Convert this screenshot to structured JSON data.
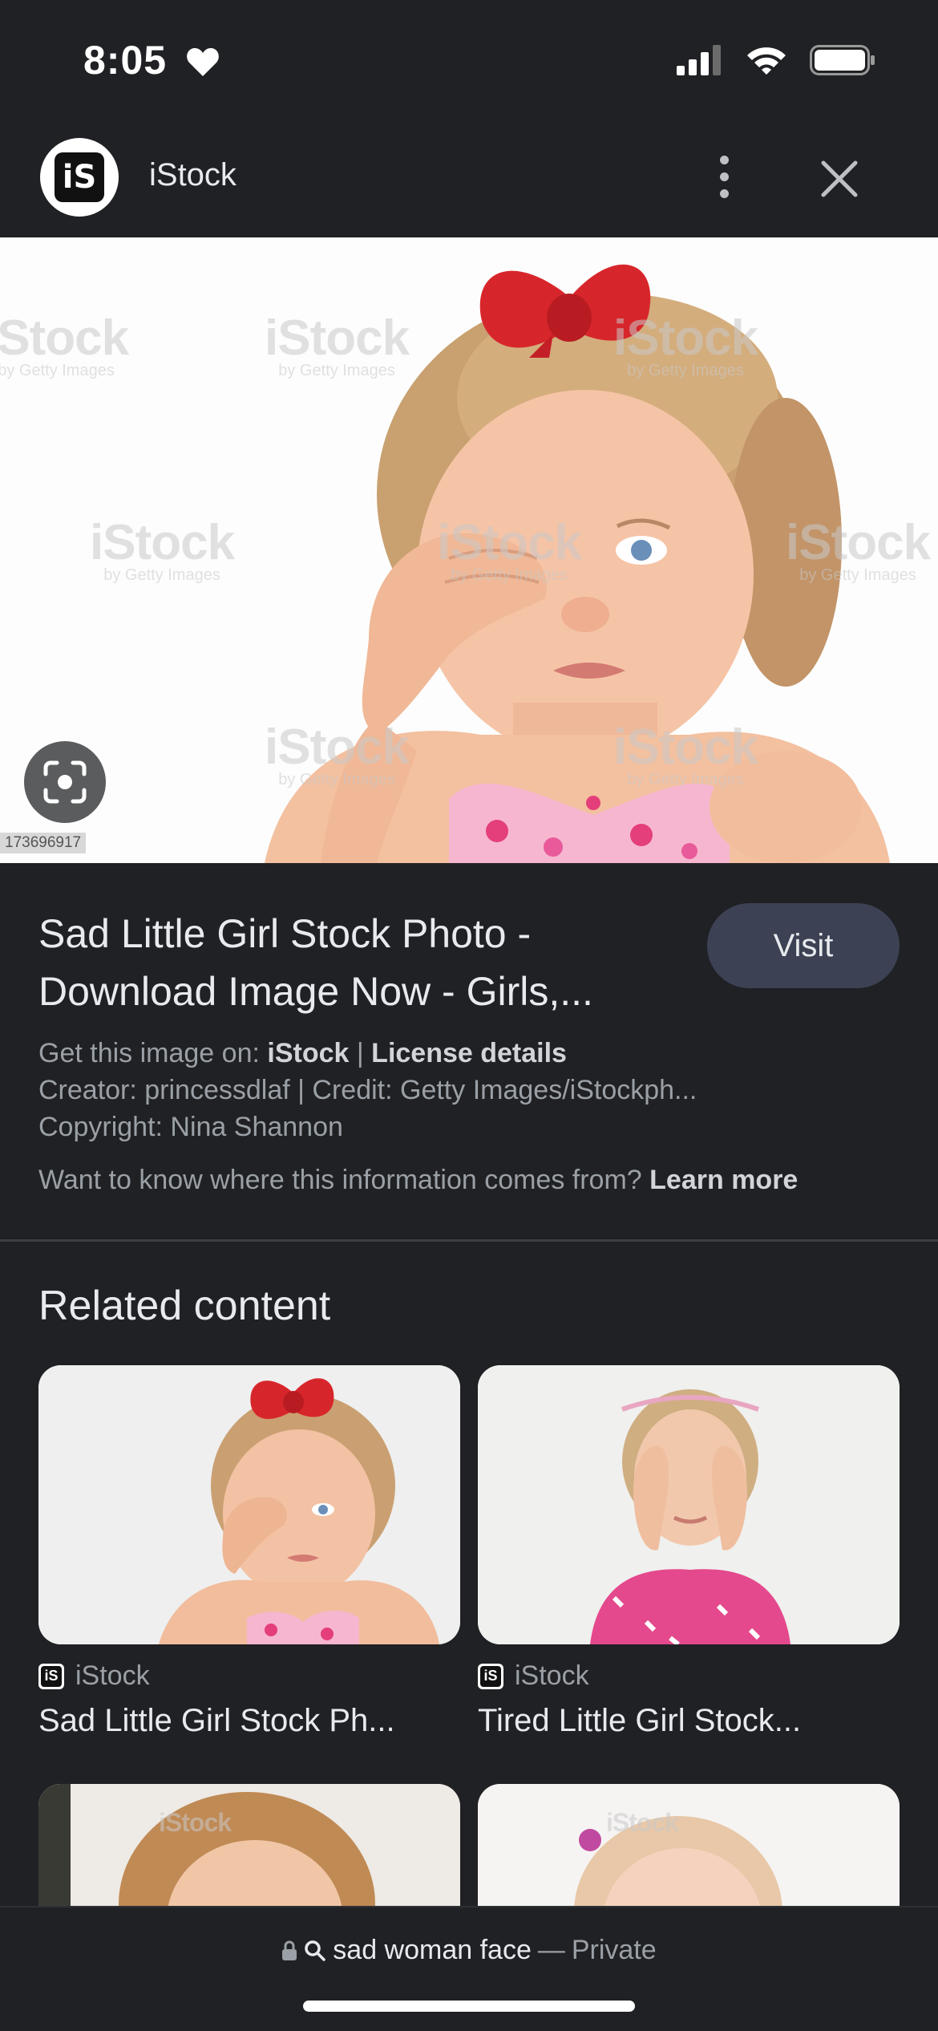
{
  "status_bar": {
    "time": "8:05"
  },
  "header": {
    "title": "iStock",
    "logo_text": "iS"
  },
  "hero": {
    "image_id": "173696917",
    "watermark_text": "iStock",
    "watermark_sub": "by Getty Images"
  },
  "info": {
    "title": "Sad Little Girl Stock Photo - Download Image Now - Girls,...",
    "visit_label": "Visit",
    "get_image_prefix": "Get this image on:",
    "get_image_source": "iStock",
    "separator": "|",
    "license_label": "License details",
    "creator_line": "Creator: princessdlaf | Credit: Getty Images/iStockph...",
    "copyright_line": "Copyright: Nina Shannon",
    "where_text": "Want to know where this information comes from?",
    "learn_more_label": "Learn more"
  },
  "related": {
    "heading": "Related content",
    "cards": [
      {
        "source": "iStock",
        "title": "Sad Little Girl Stock Ph..."
      },
      {
        "source": "iStock",
        "title": "Tired Little Girl Stock..."
      }
    ],
    "partial_watermark": "iStock"
  },
  "bottom_bar": {
    "query": "sad woman face",
    "separator": "—",
    "mode": "Private"
  },
  "colors": {
    "background": "#202124",
    "visit_button": "#3c4254",
    "text_primary": "#e8eaed",
    "text_secondary": "#9aa0a6",
    "bow_red": "#d7262b",
    "dress_pink": "#e95a9a"
  }
}
